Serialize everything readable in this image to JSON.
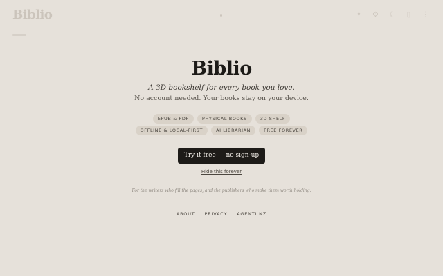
{
  "background": {
    "logo_text": "Biblio",
    "icons": [
      "sparkle-icon",
      "gear-icon",
      "moon-icon",
      "bookmark-icon",
      "more-icon"
    ]
  },
  "hero": {
    "title": "Biblio",
    "tagline": "A 3D bookshelf for every book you love.",
    "subline": "No account needed. Your books stay on your device."
  },
  "features": {
    "row1": [
      "EPUB & PDF",
      "PHYSICAL BOOKS",
      "3D SHELF"
    ],
    "row2": [
      "OFFLINE & LOCAL-FIRST",
      "AI LIBRARIAN",
      "FREE FOREVER"
    ]
  },
  "cta": {
    "primary_label": "Try it free — no sign-up",
    "hide_label": "Hide this forever"
  },
  "dedication": "For the writers who fill the pages, and the publishers who make them worth holding.",
  "footer": {
    "links": [
      "ABOUT",
      "PRIVACY",
      "AGENTI.NZ"
    ]
  },
  "colors": {
    "background": "#e6e1da",
    "button": "#1d1b18",
    "chip": "#d9d2c8"
  }
}
